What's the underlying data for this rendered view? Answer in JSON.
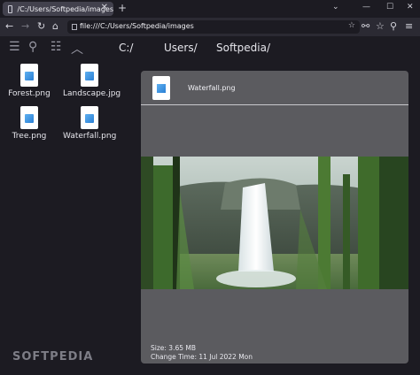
{
  "browser": {
    "tab_title": "/C:/Users/Softpedia/images",
    "new_tab_label": "+",
    "url": "file:///C:/Users/Softpedia/images"
  },
  "toolbar": {
    "breadcrumbs": [
      "C:/",
      "Users/",
      "Softpedia/"
    ]
  },
  "files": [
    {
      "name": "Forest.png"
    },
    {
      "name": "Landscape.jpg"
    },
    {
      "name": "Tree.png"
    },
    {
      "name": "Waterfall.png"
    }
  ],
  "preview": {
    "file_name": "Waterfall.png",
    "size_text": "Size: 3.65 MB",
    "change_time_text": "Change Time: 11 Jul 2022 Mon"
  },
  "watermark": "SOFTPEDIA",
  "colors": {
    "background": "#1c1b22",
    "panel": "#5b5b5f",
    "tab_active": "#42414d",
    "file_icon_accent": "#2a7fd4"
  }
}
